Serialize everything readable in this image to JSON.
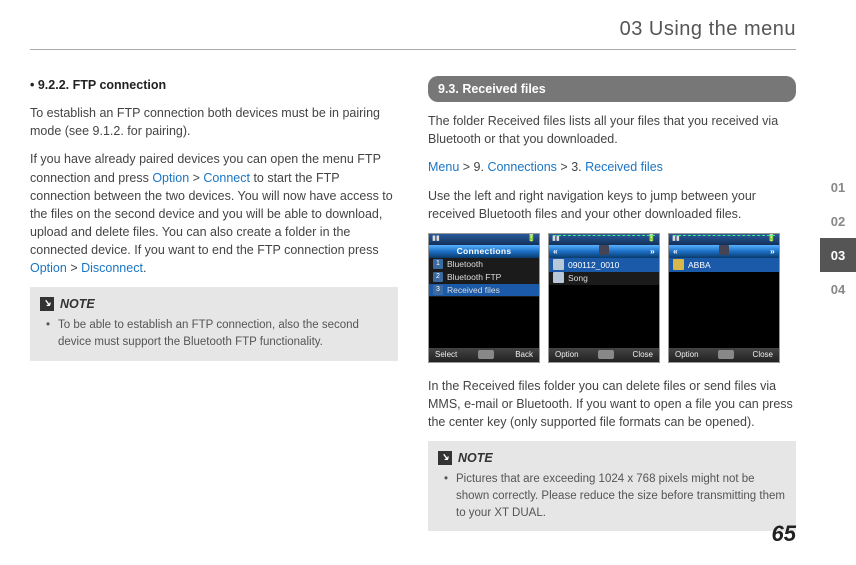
{
  "chapter_title": "03 Using the menu",
  "page_number": "65",
  "side_tabs": {
    "t1": "01",
    "t2": "02",
    "t3": "03",
    "t4": "04"
  },
  "left": {
    "head": "• 9.2.2. FTP connection",
    "p1": "To establish an FTP connection both devices must be in pairing mode (see 9.1.2. for pairing).",
    "p2a": "If you have already paired devices you can open the menu FTP connection and press ",
    "opt": "Option",
    "gt": " > ",
    "conn": "Connect",
    "p2b": " to start the FTP connection between the two devices. You will now have access to the files on the second device and you will be able to download, upload and delete files. You can also create a folder in the connected device. If you want to end the FTP connection press",
    "disc": "Disconnect",
    "dot": ".",
    "note_label": "NOTE",
    "note_text": "To be able to establish an FTP connection, also the second device must support the Bluetooth FTP functionality."
  },
  "right": {
    "section": "9.3. Received files",
    "p1": "The folder Received files lists all your files that you received via Bluetooth or that you downloaded.",
    "navMenu": "Menu",
    "gt": " > ",
    "nine": "9. ",
    "connections": "Connections",
    "three": "3. ",
    "recv": "Received files",
    "p2": "Use the left and right navigation keys to jump between your received Bluetooth files and your other downloaded files.",
    "p3": "In the Received files folder you can delete files or send files via MMS, e-mail or Bluetooth. If you want to open a file you can press the center key (only supported file formats can be opened).",
    "note_label": "NOTE",
    "note_text": "Pictures that are exceeding 1024 x 768 pixels might not be shown correctly. Please reduce the size before transmitting them to your XT DUAL.",
    "screen1": {
      "title": "Connections",
      "r1": "Bluetooth",
      "r2": "Bluetooth FTP",
      "r3": "Received files",
      "soft_l": "Select",
      "soft_r": "Back"
    },
    "screen2": {
      "row1": "090112_0010",
      "row2": "Song",
      "soft_l": "Option",
      "soft_r": "Close"
    },
    "screen3": {
      "row1": "ABBA",
      "soft_l": "Option",
      "soft_r": "Close"
    }
  }
}
